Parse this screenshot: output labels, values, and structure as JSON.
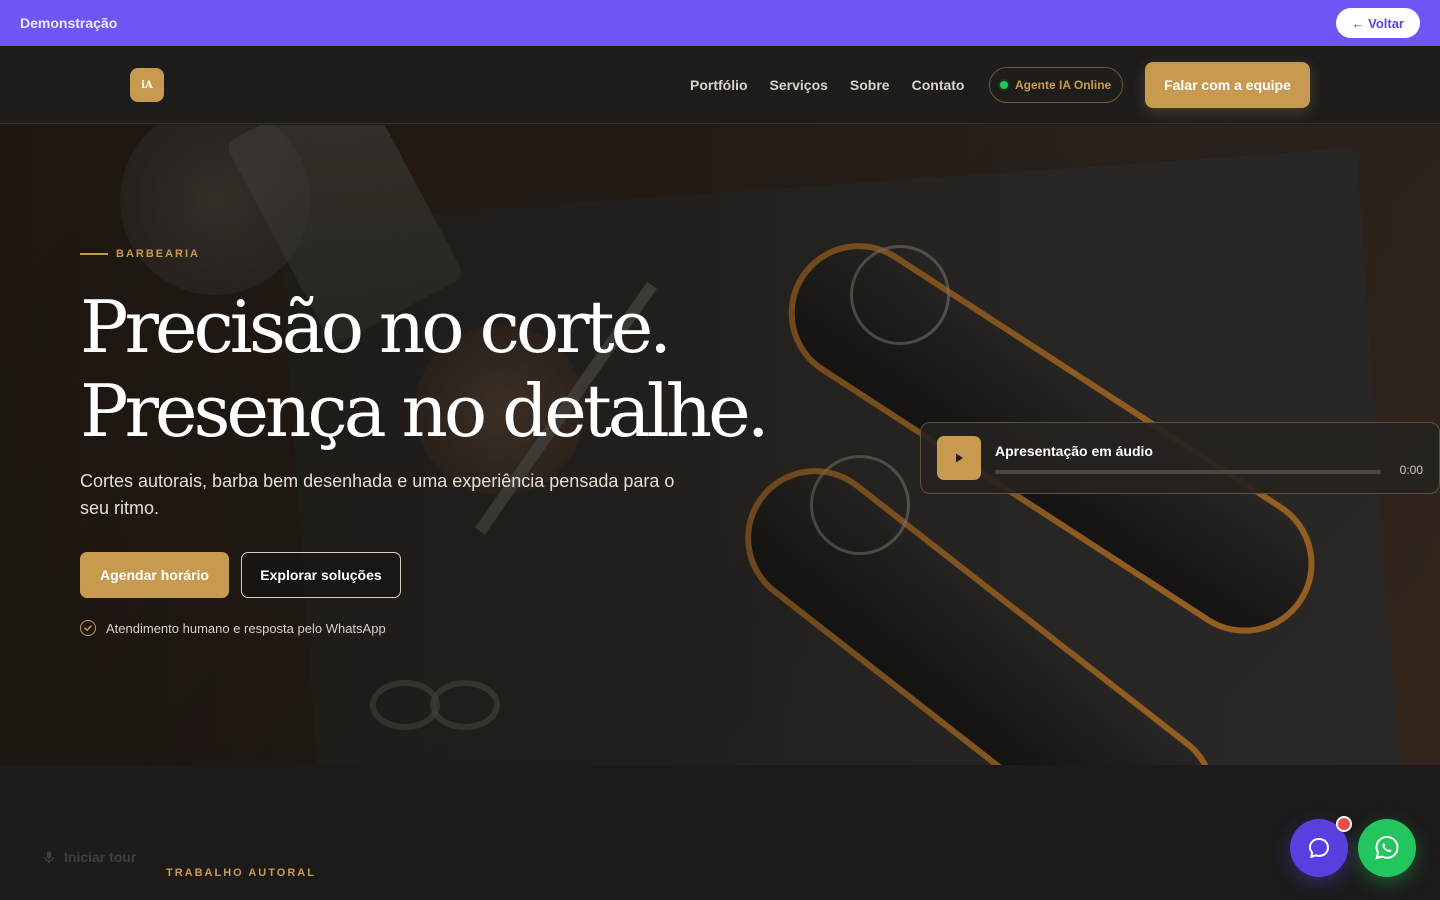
{
  "demo_bar": {
    "label": "Demonstração",
    "back_label": "← Voltar"
  },
  "nav": {
    "logo_text": "iA",
    "links": [
      "Portfólio",
      "Serviços",
      "Sobre",
      "Contato"
    ],
    "agent_status": "Agente IA Online",
    "cta": "Falar com a equipe"
  },
  "hero": {
    "eyebrow": "BARBEARIA",
    "headline_line1": "Precisão no corte.",
    "headline_line2": "Presença no detalhe.",
    "subtitle": "Cortes autorais, barba bem desenhada e uma experiência pensada para o seu ritmo.",
    "primary_cta": "Agendar horário",
    "secondary_cta": "Explorar soluções",
    "assurance": "Atendimento humano e resposta pelo WhatsApp"
  },
  "audio": {
    "title": "Apresentação em áudio",
    "time": "0:00",
    "progress": 0
  },
  "tour": {
    "label": "Iniciar tour"
  },
  "section": {
    "eyebrow": "TRABALHO AUTORAL"
  },
  "colors": {
    "accent": "#c89a50",
    "demo_bar": "#6f55f3",
    "chat": "#5a3ee0",
    "whatsapp": "#22c55e",
    "online": "#27c65a"
  },
  "icons": {
    "play": "play-icon",
    "check": "check-circle-icon",
    "chat": "chat-bubble-icon",
    "whatsapp": "whatsapp-icon",
    "mic": "mic-icon"
  }
}
